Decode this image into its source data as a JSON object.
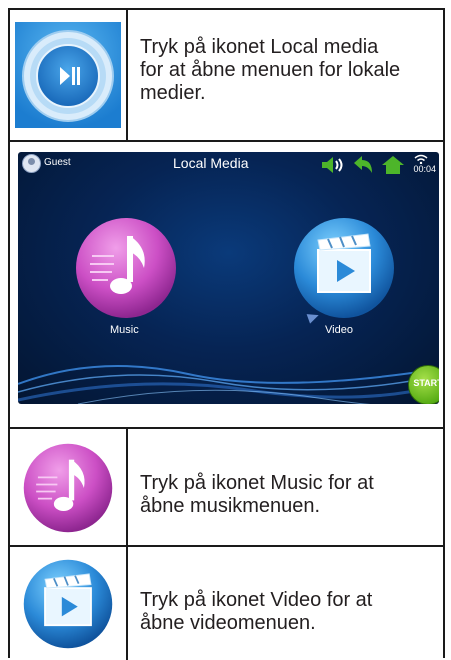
{
  "rows": [
    {
      "icon": "local-media-icon",
      "text": "Tryk på ikonet Local media for at åbne menuen for lokale medier."
    },
    {
      "icon": "screenshot"
    },
    {
      "icon": "music-icon",
      "text": "Tryk på ikonet Music for at åbne musikmenuen."
    },
    {
      "icon": "video-icon",
      "text": "Tryk på ikonet Video for at åbne videomenuen."
    }
  ],
  "row1_lines": [
    "Tryk på ikonet Local media",
    "for at åbne menuen for lokale",
    "medier."
  ],
  "row3_lines": [
    "Tryk på ikonet Music for at",
    "åbne musikmenuen."
  ],
  "row4_lines": [
    "Tryk på ikonet Video for at",
    "åbne videomenuen."
  ],
  "screenshot": {
    "user": "Guest",
    "title": "Local Media",
    "clock": "00:04",
    "music_label": "Music",
    "video_label": "Video",
    "start_label": "START",
    "icons": [
      "speaker-icon",
      "back-icon",
      "home-icon",
      "wifi-icon",
      "music-icon",
      "video-icon",
      "start-icon"
    ]
  },
  "colors": {
    "border": "#1a1a1a",
    "text": "#231f20",
    "screen_bg": "#062454",
    "status_green": "#4db52a",
    "music_purple": "#c54fc2",
    "video_blue": "#2b8ad8",
    "start_green": "#5aae16"
  }
}
